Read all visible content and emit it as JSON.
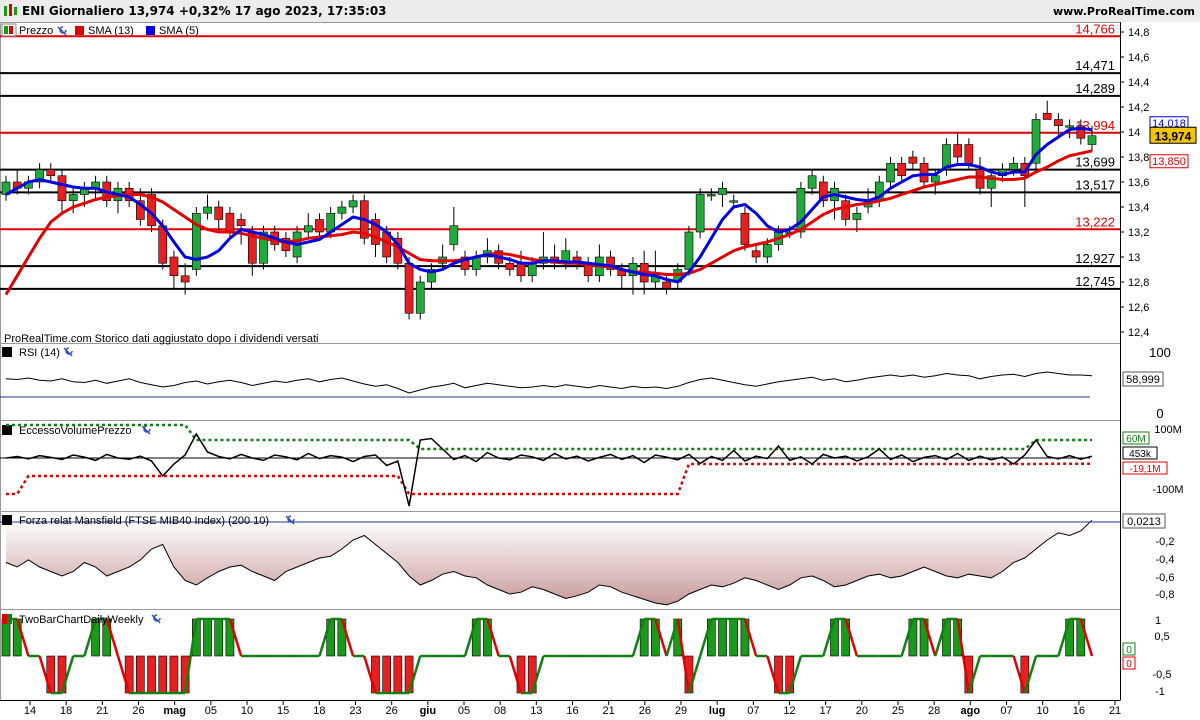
{
  "header": {
    "title": "ENI Giornaliero 13,974 +0,32% 17 ago 2023, 17:35:03",
    "site": "www.ProRealTime.com"
  },
  "price_panel": {
    "legend": [
      {
        "label": "Prezzo",
        "color": "#10a010"
      },
      {
        "label": "SMA (13)",
        "color": "#e00000"
      },
      {
        "label": "SMA (5)",
        "color": "#0000e0"
      }
    ],
    "footnote": "ProRealTime.com  Storico dati aggiustato dopo i dividendi versati",
    "y_ticks": [
      "14,8",
      "14,6",
      "14,4",
      "14,2",
      "14",
      "13,8",
      "13,6",
      "13,4",
      "13,2",
      "13",
      "12,8",
      "12,6",
      "12,4"
    ]
  },
  "rsi_panel": {
    "label": "RSI (14)",
    "value": "58,999",
    "y_ticks": [
      "100",
      "0"
    ]
  },
  "evp_panel": {
    "label": "EccessoVolumePrezzo",
    "values": [
      "60M",
      "453k",
      "-19,1M"
    ],
    "y_ticks": [
      "100M",
      "-100M"
    ]
  },
  "mansfield_panel": {
    "label": "Forza relat Mansfield (FTSE MIB40 Index) (200 10)",
    "value": "0,0213",
    "y_ticks": [
      "-0,2",
      "-0,4",
      "-0,6",
      "-0,8"
    ]
  },
  "twobar_panel": {
    "label": "TwoBarChartDailyWeekly",
    "values": [
      "0",
      "0"
    ],
    "y_ticks": [
      "1",
      "0,5",
      "-0,5",
      "-1"
    ]
  },
  "x_axis": {
    "labels": [
      "14",
      "18",
      "21",
      "26",
      "mag",
      "05",
      "10",
      "15",
      "18",
      "23",
      "26",
      "giu",
      "05",
      "08",
      "13",
      "16",
      "21",
      "26",
      "29",
      "lug",
      "07",
      "12",
      "17",
      "20",
      "25",
      "28",
      "ago",
      "07",
      "10",
      "16",
      "21"
    ]
  },
  "chart_data": {
    "type": "candlestick",
    "title": "ENI Giornaliero",
    "last": 13.974,
    "change_pct": 0.32,
    "ylim": [
      12.4,
      14.8
    ],
    "levels": [
      {
        "value": 14.766,
        "label": "14,766",
        "color": "#e00000"
      },
      {
        "value": 14.471,
        "label": "14,471",
        "color": "#000000"
      },
      {
        "value": 14.289,
        "label": "14,289",
        "color": "#000000"
      },
      {
        "value": 13.994,
        "label": "13,994",
        "color": "#e00000"
      },
      {
        "value": 13.699,
        "label": "13,699",
        "color": "#000000"
      },
      {
        "value": 13.517,
        "label": "13,517",
        "color": "#000000"
      },
      {
        "value": 13.222,
        "label": "13,222",
        "color": "#e00000"
      },
      {
        "value": 12.927,
        "label": "12,927",
        "color": "#000000"
      },
      {
        "value": 12.745,
        "label": "12,745",
        "color": "#000000"
      }
    ],
    "badges": [
      {
        "value": 14.018,
        "label": "14,018",
        "kind": "sma5"
      },
      {
        "value": 13.974,
        "label": "13,974",
        "kind": "price"
      },
      {
        "value": 13.85,
        "label": "13,850",
        "kind": "sma13"
      }
    ],
    "candles": [
      [
        13.5,
        13.65,
        13.45,
        13.6
      ],
      [
        13.6,
        13.7,
        13.5,
        13.55
      ],
      [
        13.55,
        13.65,
        13.5,
        13.6
      ],
      [
        13.6,
        13.75,
        13.55,
        13.7
      ],
      [
        13.7,
        13.75,
        13.6,
        13.65
      ],
      [
        13.65,
        13.7,
        13.35,
        13.45
      ],
      [
        13.45,
        13.55,
        13.35,
        13.5
      ],
      [
        13.5,
        13.6,
        13.4,
        13.55
      ],
      [
        13.55,
        13.65,
        13.45,
        13.6
      ],
      [
        13.6,
        13.65,
        13.4,
        13.45
      ],
      [
        13.45,
        13.6,
        13.35,
        13.55
      ],
      [
        13.55,
        13.6,
        13.4,
        13.45
      ],
      [
        13.45,
        13.55,
        13.25,
        13.3
      ],
      [
        13.5,
        13.55,
        13.2,
        13.25
      ],
      [
        13.25,
        13.3,
        12.9,
        12.95
      ],
      [
        13.0,
        13.05,
        12.75,
        12.85
      ],
      [
        12.85,
        12.95,
        12.7,
        12.8
      ],
      [
        12.9,
        13.4,
        12.85,
        13.35
      ],
      [
        13.35,
        13.5,
        13.3,
        13.4
      ],
      [
        13.4,
        13.45,
        13.2,
        13.3
      ],
      [
        13.35,
        13.4,
        13.15,
        13.2
      ],
      [
        13.3,
        13.35,
        13.1,
        13.25
      ],
      [
        13.2,
        13.25,
        12.85,
        12.95
      ],
      [
        12.95,
        13.25,
        12.9,
        13.2
      ],
      [
        13.2,
        13.25,
        13.05,
        13.1
      ],
      [
        13.15,
        13.2,
        13.0,
        13.05
      ],
      [
        13.0,
        13.25,
        12.95,
        13.2
      ],
      [
        13.2,
        13.35,
        13.15,
        13.25
      ],
      [
        13.3,
        13.35,
        13.15,
        13.2
      ],
      [
        13.2,
        13.4,
        13.15,
        13.35
      ],
      [
        13.35,
        13.45,
        13.3,
        13.4
      ],
      [
        13.4,
        13.5,
        13.35,
        13.45
      ],
      [
        13.45,
        13.5,
        13.1,
        13.15
      ],
      [
        13.3,
        13.35,
        13.0,
        13.1
      ],
      [
        13.2,
        13.25,
        12.95,
        13.0
      ],
      [
        13.15,
        13.2,
        12.9,
        12.95
      ],
      [
        12.95,
        13.0,
        12.5,
        12.55
      ],
      [
        12.55,
        12.85,
        12.5,
        12.8
      ],
      [
        12.8,
        12.95,
        12.75,
        12.9
      ],
      [
        12.95,
        13.1,
        12.9,
        13.0
      ],
      [
        13.1,
        13.4,
        13.05,
        13.25
      ],
      [
        13.0,
        13.05,
        12.85,
        12.9
      ],
      [
        12.9,
        13.05,
        12.85,
        13.0
      ],
      [
        13.0,
        13.15,
        12.95,
        13.05
      ],
      [
        13.05,
        13.1,
        12.9,
        12.95
      ],
      [
        12.95,
        13.0,
        12.85,
        12.9
      ],
      [
        12.95,
        13.05,
        12.8,
        12.85
      ],
      [
        12.85,
        13.0,
        12.8,
        12.95
      ],
      [
        12.95,
        13.2,
        12.9,
        13.0
      ],
      [
        13.0,
        13.1,
        12.9,
        12.95
      ],
      [
        12.95,
        13.15,
        12.9,
        13.05
      ],
      [
        13.0,
        13.05,
        12.9,
        12.95
      ],
      [
        12.95,
        13.0,
        12.8,
        12.85
      ],
      [
        12.85,
        13.1,
        12.8,
        13.0
      ],
      [
        13.0,
        13.05,
        12.85,
        12.9
      ],
      [
        12.9,
        12.95,
        12.75,
        12.85
      ],
      [
        12.85,
        13.0,
        12.7,
        12.95
      ],
      [
        12.95,
        13.05,
        12.7,
        12.8
      ],
      [
        12.8,
        13.05,
        12.75,
        12.85
      ],
      [
        12.8,
        12.85,
        12.7,
        12.75
      ],
      [
        12.8,
        12.95,
        12.75,
        12.9
      ],
      [
        12.9,
        13.25,
        12.85,
        13.2
      ],
      [
        13.2,
        13.55,
        13.15,
        13.5
      ],
      [
        13.5,
        13.55,
        13.45,
        13.5
      ],
      [
        13.5,
        13.6,
        13.4,
        13.55
      ],
      [
        13.45,
        13.5,
        13.4,
        13.45
      ],
      [
        13.35,
        13.4,
        13.05,
        13.1
      ],
      [
        13.05,
        13.1,
        12.95,
        13.0
      ],
      [
        13.0,
        13.15,
        12.95,
        13.1
      ],
      [
        13.1,
        13.25,
        13.05,
        13.2
      ],
      [
        13.2,
        13.25,
        13.15,
        13.2
      ],
      [
        13.2,
        13.6,
        13.15,
        13.55
      ],
      [
        13.55,
        13.7,
        13.5,
        13.65
      ],
      [
        13.6,
        13.65,
        13.4,
        13.45
      ],
      [
        13.45,
        13.6,
        13.3,
        13.55
      ],
      [
        13.45,
        13.5,
        13.25,
        13.3
      ],
      [
        13.3,
        13.4,
        13.2,
        13.35
      ],
      [
        13.4,
        13.55,
        13.35,
        13.45
      ],
      [
        13.45,
        13.65,
        13.4,
        13.6
      ],
      [
        13.6,
        13.8,
        13.55,
        13.75
      ],
      [
        13.75,
        13.8,
        13.6,
        13.65
      ],
      [
        13.8,
        13.85,
        13.7,
        13.75
      ],
      [
        13.75,
        13.8,
        13.55,
        13.6
      ],
      [
        13.6,
        13.7,
        13.5,
        13.65
      ],
      [
        13.7,
        13.95,
        13.65,
        13.9
      ],
      [
        13.9,
        14.0,
        13.75,
        13.8
      ],
      [
        13.9,
        13.95,
        13.7,
        13.75
      ],
      [
        13.7,
        13.8,
        13.5,
        13.55
      ],
      [
        13.55,
        13.7,
        13.4,
        13.65
      ],
      [
        13.65,
        13.75,
        13.6,
        13.7
      ],
      [
        13.7,
        13.8,
        13.65,
        13.75
      ],
      [
        13.75,
        13.8,
        13.4,
        13.65
      ],
      [
        13.75,
        14.15,
        13.7,
        14.1
      ],
      [
        14.15,
        14.25,
        14.1,
        14.1
      ],
      [
        14.1,
        14.15,
        13.95,
        14.05
      ],
      [
        14.05,
        14.1,
        13.95,
        14.05
      ],
      [
        14.05,
        14.1,
        13.9,
        13.95
      ],
      [
        13.9,
        14.05,
        13.85,
        13.97
      ]
    ],
    "sma5": [
      13.5,
      13.55,
      13.6,
      13.62,
      13.6,
      13.58,
      13.56,
      13.55,
      13.55,
      13.52,
      13.5,
      13.48,
      13.42,
      13.35,
      13.25,
      13.12,
      13.0,
      12.98,
      13.0,
      13.05,
      13.15,
      13.22,
      13.2,
      13.18,
      13.15,
      13.12,
      13.1,
      13.12,
      13.14,
      13.2,
      13.26,
      13.32,
      13.3,
      13.26,
      13.2,
      13.1,
      12.95,
      12.9,
      12.88,
      12.9,
      12.95,
      12.98,
      13.0,
      13.02,
      13.0,
      12.98,
      12.95,
      12.95,
      12.97,
      12.97,
      12.96,
      12.96,
      12.95,
      12.94,
      12.93,
      12.9,
      12.88,
      12.86,
      12.85,
      12.82,
      12.8,
      12.88,
      13.0,
      13.15,
      13.3,
      13.4,
      13.42,
      13.35,
      13.25,
      13.2,
      13.22,
      13.28,
      13.38,
      13.48,
      13.5,
      13.48,
      13.46,
      13.45,
      13.48,
      13.55,
      13.6,
      13.65,
      13.66,
      13.66,
      13.72,
      13.74,
      13.74,
      13.72,
      13.68,
      13.66,
      13.68,
      13.68,
      13.82,
      13.9,
      13.96,
      14.02,
      14.03,
      14.018
    ],
    "sma13": [
      12.7,
      12.85,
      13.0,
      13.15,
      13.28,
      13.35,
      13.4,
      13.43,
      13.46,
      13.48,
      13.49,
      13.5,
      13.5,
      13.48,
      13.44,
      13.38,
      13.32,
      13.26,
      13.22,
      13.2,
      13.2,
      13.19,
      13.17,
      13.15,
      13.13,
      13.12,
      13.13,
      13.15,
      13.16,
      13.17,
      13.18,
      13.2,
      13.19,
      13.16,
      13.12,
      13.08,
      13.03,
      12.98,
      12.97,
      12.97,
      12.97,
      12.98,
      13.0,
      13.02,
      13.03,
      13.02,
      13.0,
      12.98,
      12.97,
      12.96,
      12.95,
      12.95,
      12.94,
      12.93,
      12.92,
      12.9,
      12.88,
      12.88,
      12.87,
      12.86,
      12.86,
      12.87,
      12.9,
      12.95,
      13.0,
      13.05,
      13.08,
      13.1,
      13.12,
      13.15,
      13.18,
      13.22,
      13.28,
      13.34,
      13.38,
      13.4,
      13.42,
      13.43,
      13.45,
      13.47,
      13.5,
      13.53,
      13.56,
      13.58,
      13.6,
      13.62,
      13.64,
      13.64,
      13.63,
      13.62,
      13.62,
      13.63,
      13.68,
      13.72,
      13.77,
      13.81,
      13.83,
      13.85
    ],
    "rsi": [
      55,
      54,
      56,
      53,
      52,
      55,
      51,
      50,
      53,
      49,
      52,
      55,
      50,
      47,
      44,
      46,
      50,
      52,
      48,
      51,
      53,
      50,
      46,
      49,
      52,
      50,
      53,
      55,
      51,
      54,
      56,
      52,
      48,
      45,
      47,
      42,
      36,
      40,
      44,
      46,
      49,
      43,
      46,
      49,
      47,
      45,
      43,
      44,
      46,
      44,
      47,
      45,
      43,
      46,
      44,
      42,
      45,
      43,
      44,
      42,
      45,
      50,
      54,
      56,
      53,
      50,
      47,
      45,
      48,
      51,
      53,
      55,
      57,
      53,
      55,
      51,
      53,
      56,
      58,
      60,
      58,
      60,
      57,
      59,
      62,
      60,
      59,
      55,
      58,
      60,
      61,
      58,
      62,
      64,
      62,
      60,
      60,
      59
    ],
    "evp_line": [
      0,
      5,
      -3,
      8,
      2,
      -5,
      10,
      3,
      -8,
      12,
      0,
      -4,
      6,
      -10,
      -60,
      -20,
      10,
      80,
      20,
      5,
      -3,
      12,
      0,
      -8,
      10,
      4,
      -6,
      15,
      -2,
      8,
      3,
      -12,
      5,
      10,
      -25,
      -10,
      -160,
      60,
      65,
      30,
      -5,
      8,
      -12,
      18,
      0,
      -6,
      10,
      4,
      -8,
      15,
      -3,
      6,
      -10,
      2,
      12,
      -5,
      8,
      -15,
      10,
      3,
      -6,
      12,
      -18,
      5,
      -8,
      25,
      -10,
      6,
      -2,
      40,
      -8,
      4,
      -20,
      12,
      0,
      6,
      -10,
      4,
      30,
      -5,
      10,
      -12,
      2,
      8,
      -5,
      15,
      -8,
      6,
      -6,
      3,
      -20,
      10,
      60,
      5,
      -3,
      8,
      -4,
      6
    ],
    "evp_upper": [
      110,
      110,
      110,
      110,
      110,
      110,
      110,
      110,
      110,
      110,
      110,
      110,
      110,
      110,
      110,
      110,
      110,
      60,
      60,
      60,
      60,
      60,
      60,
      60,
      60,
      60,
      60,
      60,
      60,
      60,
      60,
      60,
      60,
      60,
      60,
      60,
      60,
      30,
      30,
      30,
      30,
      30,
      30,
      30,
      30,
      30,
      30,
      30,
      30,
      30,
      30,
      30,
      30,
      30,
      30,
      30,
      30,
      30,
      30,
      30,
      30,
      30,
      30,
      30,
      30,
      30,
      30,
      30,
      30,
      30,
      30,
      30,
      30,
      30,
      30,
      30,
      30,
      30,
      30,
      30,
      30,
      30,
      30,
      30,
      30,
      30,
      30,
      30,
      30,
      30,
      30,
      30,
      60,
      60,
      60,
      60,
      60,
      60
    ],
    "evp_lower": [
      -120,
      -120,
      -60,
      -60,
      -60,
      -60,
      -60,
      -60,
      -60,
      -60,
      -60,
      -60,
      -60,
      -60,
      -60,
      -60,
      -60,
      -60,
      -60,
      -60,
      -60,
      -60,
      -60,
      -60,
      -60,
      -60,
      -60,
      -60,
      -60,
      -60,
      -60,
      -60,
      -60,
      -60,
      -60,
      -60,
      -120,
      -120,
      -120,
      -120,
      -120,
      -120,
      -120,
      -120,
      -120,
      -120,
      -120,
      -120,
      -120,
      -120,
      -120,
      -120,
      -120,
      -120,
      -120,
      -120,
      -120,
      -120,
      -120,
      -120,
      -120,
      -20,
      -20,
      -20,
      -20,
      -20,
      -20,
      -20,
      -20,
      -20,
      -20,
      -20,
      -20,
      -20,
      -20,
      -20,
      -20,
      -20,
      -20,
      -20,
      -20,
      -20,
      -20,
      -20,
      -20,
      -20,
      -20,
      -20,
      -20,
      -20,
      -20,
      -20,
      -20,
      -19,
      -19,
      -19,
      -19,
      -19
    ],
    "mansfield": [
      -0.45,
      -0.5,
      -0.42,
      -0.5,
      -0.55,
      -0.6,
      -0.55,
      -0.45,
      -0.5,
      -0.6,
      -0.55,
      -0.5,
      -0.42,
      -0.3,
      -0.25,
      -0.5,
      -0.65,
      -0.7,
      -0.62,
      -0.55,
      -0.5,
      -0.48,
      -0.55,
      -0.6,
      -0.65,
      -0.55,
      -0.5,
      -0.45,
      -0.4,
      -0.38,
      -0.3,
      -0.2,
      -0.15,
      -0.25,
      -0.35,
      -0.45,
      -0.6,
      -0.7,
      -0.65,
      -0.58,
      -0.55,
      -0.6,
      -0.62,
      -0.7,
      -0.75,
      -0.8,
      -0.78,
      -0.72,
      -0.75,
      -0.8,
      -0.85,
      -0.82,
      -0.78,
      -0.7,
      -0.72,
      -0.78,
      -0.82,
      -0.86,
      -0.9,
      -0.92,
      -0.88,
      -0.8,
      -0.75,
      -0.7,
      -0.72,
      -0.68,
      -0.62,
      -0.65,
      -0.7,
      -0.75,
      -0.7,
      -0.62,
      -0.6,
      -0.65,
      -0.72,
      -0.7,
      -0.65,
      -0.6,
      -0.58,
      -0.62,
      -0.6,
      -0.55,
      -0.5,
      -0.55,
      -0.6,
      -0.62,
      -0.58,
      -0.6,
      -0.62,
      -0.55,
      -0.45,
      -0.4,
      -0.3,
      -0.2,
      -0.12,
      -0.15,
      -0.1,
      0.02
    ],
    "twobar": [
      1,
      1,
      0,
      0,
      -1,
      -1,
      0,
      0,
      1,
      1,
      0,
      -1,
      -1,
      -1,
      -1,
      -1,
      -1,
      1,
      1,
      1,
      1,
      0,
      0,
      0,
      0,
      0,
      0,
      0,
      0,
      1,
      1,
      0,
      0,
      -1,
      -1,
      -1,
      -1,
      0,
      0,
      0,
      0,
      0,
      1,
      1,
      0,
      0,
      -1,
      -1,
      0,
      0,
      0,
      0,
      0,
      0,
      0,
      0,
      0,
      1,
      1,
      0,
      1,
      -1,
      0,
      1,
      1,
      1,
      1,
      0,
      0,
      -1,
      -1,
      0,
      0,
      0,
      1,
      1,
      0,
      0,
      0,
      0,
      0,
      1,
      1,
      0,
      1,
      1,
      -1,
      0,
      0,
      0,
      0,
      -1,
      0,
      0,
      0,
      1,
      1,
      0
    ]
  }
}
